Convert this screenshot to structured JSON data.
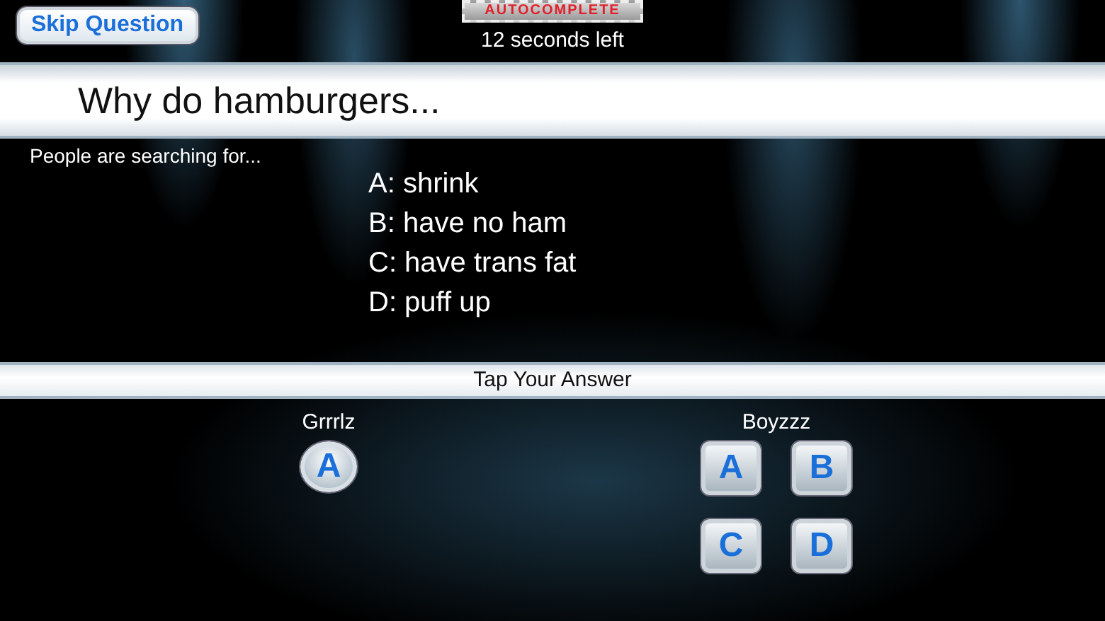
{
  "header": {
    "skip_button": "Skip Question",
    "mode_badge": "AUTOCOMPLETE",
    "timer": "12 seconds left"
  },
  "question": "Why do hamburgers...",
  "prompt": "People are searching for...",
  "choices": [
    "A: shrink",
    "B: have no ham",
    "C: have trans fat",
    "D: puff up"
  ],
  "answer_bar": "Tap Your Answer",
  "teams": [
    {
      "name": "Grrrlz",
      "kind": "round",
      "buttons": [
        "A"
      ]
    },
    {
      "name": "Boyzzz",
      "kind": "square",
      "buttons": [
        "A",
        "B",
        "C",
        "D"
      ]
    }
  ]
}
